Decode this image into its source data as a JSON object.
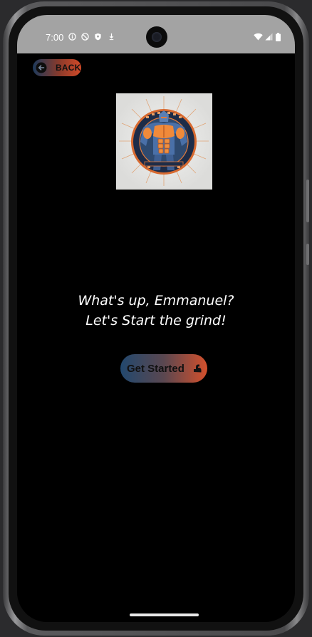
{
  "status_bar": {
    "time": "7:00",
    "icons": [
      "info-icon",
      "dnd-icon",
      "shield-icon",
      "download-icon"
    ],
    "right_icons": [
      "wifi-icon",
      "signal-icon",
      "battery-icon"
    ]
  },
  "header": {
    "back_label": "BACK",
    "back_icon": "arrow-left-circle-icon"
  },
  "logo": {
    "icon": "muscular-robot-emblem"
  },
  "greeting": {
    "line1": "What's up, Emmanuel?",
    "line2": "Let's Start the grind!"
  },
  "cta": {
    "label": "Get Started",
    "icon": "flexed-arm-icon"
  },
  "colors": {
    "background": "#000000",
    "accent_blue": "#22486e",
    "accent_orange": "#d4502c",
    "status_bar": "#a3a3a3"
  }
}
